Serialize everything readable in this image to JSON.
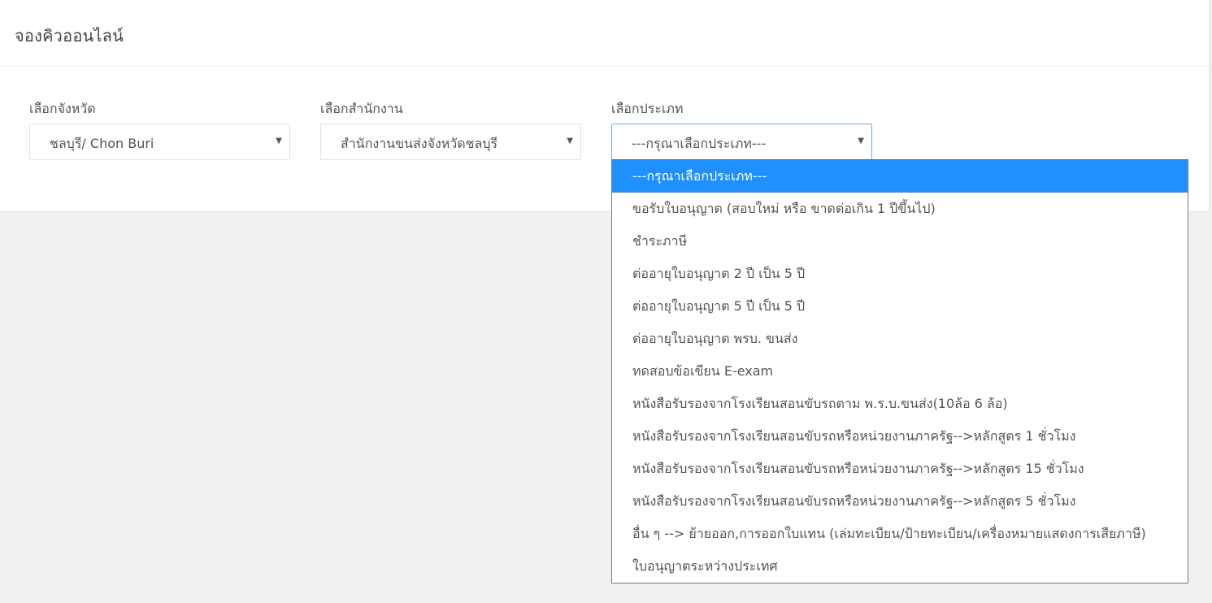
{
  "page": {
    "title": "จองคิวออนไลน์"
  },
  "filters": {
    "province": {
      "label": "เลือกจังหวัด",
      "value": "ชลบุรี/ Chon Buri"
    },
    "office": {
      "label": "เลือกสำนักงาน",
      "value": "สำนักงานขนส่งจังหวัดชลบุรี"
    },
    "type": {
      "label": "เลือกประเภท",
      "value": "---กรุณาเลือกประเภท---",
      "options": [
        "---กรุณาเลือกประเภท---",
        "ขอรับใบอนุญาต (สอบใหม่ หรือ ขาดต่อเกิน 1 ปีขึ้นไป)",
        "ชำระภาษี",
        "ต่ออายุใบอนุญาต 2 ปี เป็น 5 ปี",
        "ต่ออายุใบอนุญาต 5 ปี เป็น 5 ปี",
        "ต่ออายุใบอนุญาต พรบ. ขนส่ง",
        "ทดสอบข้อเขียน E-exam",
        "หนังสือรับรองจากโรงเรียนสอนขับรถตาม พ.ร.บ.ขนส่ง(10ล้อ 6 ล้อ)",
        "หนังสือรับรองจากโรงเรียนสอนขับรถหรือหน่วยงานภาครัฐ-->หลักสูตร 1 ชั่วโมง",
        "หนังสือรับรองจากโรงเรียนสอนขับรถหรือหน่วยงานภาครัฐ-->หลักสูตร 15 ชั่วโมง",
        "หนังสือรับรองจากโรงเรียนสอนขับรถหรือหน่วยงานภาครัฐ-->หลักสูตร 5 ชั่วโมง",
        "อื่น ๆ --> ย้ายออก,การออกใบแทน (เล่มทะเบียน/ป้ายทะเบียน/เครื่องหมายแสดงการเสียภาษี)",
        "ใบอนุญาตระหว่างประเทศ"
      ],
      "selected_index": 0
    }
  },
  "icons": {
    "caret": "caret-down-icon"
  },
  "colors": {
    "highlight": "#1e90ff",
    "background": "#f1f1f1"
  }
}
